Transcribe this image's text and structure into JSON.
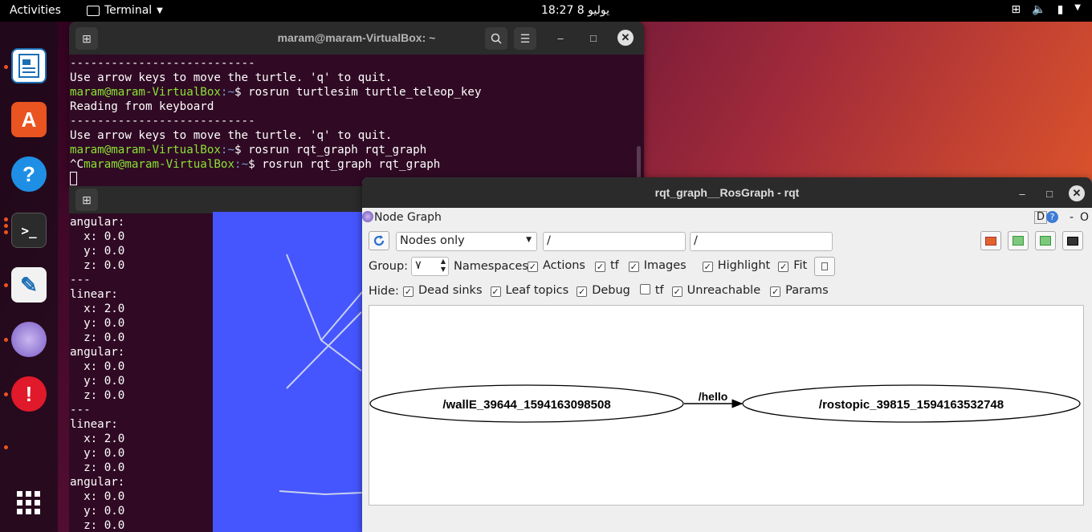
{
  "topbar": {
    "activities": "Activities",
    "app_name": "Terminal",
    "clock": "18:27  يوليو 8"
  },
  "dock": {
    "items": [
      "libreoffice-writer-icon",
      "software-center-icon",
      "help-icon",
      "terminal-icon",
      "text-editor-icon",
      "rqt-icon",
      "error-report-icon",
      "show-apps-icon"
    ]
  },
  "terminal1": {
    "title": "maram@maram-VirtualBox: ~",
    "lines": [
      {
        "t": "---------------------------"
      },
      {
        "t": "Use arrow keys to move the turtle. 'q' to quit."
      },
      {
        "user": "maram@maram-VirtualBox",
        "path": "~",
        "cmd": "$ rosrun turtlesim turtle_teleop_key"
      },
      {
        "t": "Reading from keyboard"
      },
      {
        "t": "---------------------------"
      },
      {
        "t": "Use arrow keys to move the turtle. 'q' to quit."
      },
      {
        "user": "maram@maram-VirtualBox",
        "path": "~",
        "cmd": "$ rosrun rqt_graph rqt_graph"
      },
      {
        "pre": "^C",
        "user": "maram@maram-VirtualBox",
        "path": "~",
        "cmd": "$ rosrun rqt_graph rqt_graph"
      }
    ]
  },
  "terminal2": {
    "lines": [
      "angular:",
      "  x: 0.0",
      "  y: 0.0",
      "  z: 0.0",
      "---",
      "linear:",
      "  x: 2.0",
      "  y: 0.0",
      "  z: 0.0",
      "angular:",
      "  x: 0.0",
      "  y: 0.0",
      "  z: 0.0",
      "---",
      "linear:",
      "  x: 2.0",
      "  y: 0.0",
      "  z: 0.0",
      "angular:",
      "  x: 0.0",
      "  y: 0.0",
      "  z: 0.0"
    ]
  },
  "rqt": {
    "title": "rqt_graph__RosGraph - rqt",
    "plugin_title": "Node Graph",
    "plugin_d": "D",
    "plugin_help": "?",
    "plugin_dash": "-",
    "plugin_o": "O",
    "mode_select": "Nodes only",
    "filter1": "/",
    "filter2": "/",
    "group_label": "Group:",
    "group_value": "٧",
    "namespaces_label": "Namespaces",
    "options": [
      {
        "label": "Actions",
        "checked": true
      },
      {
        "label": "tf",
        "checked": true
      },
      {
        "label": "Images",
        "checked": true
      },
      {
        "label": "Highlight",
        "checked": true
      },
      {
        "label": "Fit",
        "checked": true
      }
    ],
    "hide_label": "Hide:",
    "hide_options": [
      {
        "label": "Dead sinks",
        "checked": true
      },
      {
        "label": "Leaf topics",
        "checked": true
      },
      {
        "label": "Debug",
        "checked": true
      },
      {
        "label": "tf",
        "checked": false
      },
      {
        "label": "Unreachable",
        "checked": true
      },
      {
        "label": "Params",
        "checked": true
      }
    ],
    "graph": {
      "node1": "/wallE_39644_1594163098508",
      "edge": "/hello",
      "node2": "/rostopic_39815_1594163532748"
    }
  },
  "colors": {
    "accent": "#e95420",
    "terminal_bg": "#300a24",
    "turtle_bg": "#4556ff",
    "prompt_user": "#8ae234",
    "prompt_path": "#729fcf"
  }
}
